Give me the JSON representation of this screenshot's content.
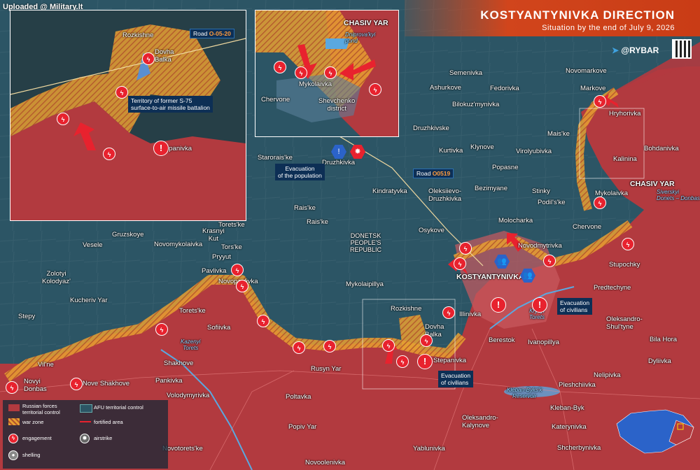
{
  "watermark": "Uploaded @ Military.lt",
  "header": {
    "title": "KOSTYANTYNIVKA DIRECTION",
    "subtitle": "Situation by the end of July 9, 2026",
    "brand": "@RYBAR"
  },
  "colors": {
    "russian": "#b23a3f",
    "afu": "#2c5565",
    "war_zone": "#e8a031",
    "accent": "#d1451c",
    "engagement": "#e8222e",
    "afu_icon": "#2b63c9"
  },
  "region_label": "DONETSK\nPEOPLE'S\nREPUBLIC",
  "places": {
    "semenivka": "Semenivka",
    "novomarkove": "Novomarkove",
    "ashurkove": "Ashurkove",
    "fedorivka": "Fedorivka",
    "markove": "Markove",
    "bilokuzmynivka": "Bilokuz'mynivka",
    "hryhorivka": "Hryhorivka",
    "druzhkivske": "Druzhkivske",
    "mais_ke": "Mais'ke",
    "kurtivka": "Kurtivka",
    "klynove": "Klynove",
    "virolyubivka": "Virolyubivka",
    "bohdanivka": "Bohdanivka",
    "starorais_ke": "Starorais'ke",
    "druzhkivka": "Druzhkivka",
    "kalinina": "Kalinina",
    "popasne": "Popasne",
    "bezimyane": "Bezimyane",
    "chasiv_yar": "CHASIV YAR",
    "stinky": "Stinky",
    "kindratyvka": "Kindratyvka",
    "oleksiievo": "Oleksiievo-\nDruzhkivka",
    "mykolaivka": "Mykolaivka",
    "rais_ke_1": "Rais'ke",
    "rais_ke_2": "Rais'ke",
    "podil_s_ke": "Podil's'ke",
    "toretske_top": "Torets'ke",
    "krasnyi_kut": "Krasnyi\nKut",
    "tors_ke": "Tors'ke",
    "pryyut": "Pryyut",
    "gruzskoye": "Gruzskoye",
    "vesele": "Vesele",
    "novomykolaivka": "Novomykolaivka",
    "osykove": "Osykove",
    "molocharka": "Molocharka",
    "chervone": "Chervone",
    "novodmytrivka": "Novodmytrivka",
    "stupochky": "Stupochky",
    "pavlivka": "Pavlivka",
    "zolotyi_kolodyaz": "Zolotyi\nKolodyaz'",
    "novopavlivka": "Novopavlivka",
    "mykolaipillya": "Mykolaipillya",
    "kostyantynivka": "KOSTYANTYNIVKA",
    "predtechyne": "Predtechyne",
    "kucheriv_yar": "Kucheriv Yar",
    "toretske_mid": "Torets'ke",
    "rozkishne": "Rozkishne",
    "dovha_balka": "Dovha\nBalka",
    "illinivka": "Illinivka",
    "stepy": "Stepy",
    "sofiivka": "Sofiivka",
    "oleksandro_shultyne": "Oleksandro-\nShul'tyne",
    "berestok": "Berestok",
    "ivanopillya": "Ivanopillya",
    "bila_hora": "Bila Hora",
    "shakhove": "Shakhove",
    "stepanivka": "Stepanivka",
    "rusyn_yar": "Rusyn Yar",
    "dyliivka": "Dyliivka",
    "vil_ne": "Vil'ne",
    "novyi_donbas": "Novyi\nDonbas",
    "nove_shakhove": "Nove Shakhove",
    "pankivka": "Pankivka",
    "nelipivka": "Nelipivka",
    "pleshchiivka": "Pleshchiivka",
    "volodymyrivka": "Volodymyrivka",
    "poltavka": "Poltavka",
    "kleban_byk": "Kleban-Byk",
    "popiv_yar": "Popiv Yar",
    "oleksandro_kalynove": "Oleksandro-\nKalynove",
    "katerynivka": "Katerynivka",
    "novotoretske": "Novotorets'ke",
    "yablunivka": "Yablunivka",
    "shcherbynivka": "Shcherbynivka",
    "novoolenivka": "Novoolenivka"
  },
  "water": {
    "kazenyi_torets": "Kazenyi\nTorets",
    "kryvyi_torets": "Kryvyi\nTorets",
    "kleban_byk_reservoir": "Kleban-Byks'k\nReservoir",
    "siverskyi_donets": "Siverskyi\nDonets – Donbas"
  },
  "callouts": {
    "road_top_prefix": "Road ",
    "road_top_code": "O0519",
    "evac_population": "Evacuation\nof the population",
    "evac_civilians_1": "Evacuation\nof civilians",
    "evac_civilians_2": "Evacuation\nof civilians"
  },
  "inset1": {
    "road_prefix": "Road ",
    "road_code": "O-05-20",
    "rozkishne": "Rozkishne",
    "dovha_balka": "Dovha\nBalka",
    "s75": "Territory of former S-75\nsurface-to-air missile battalion",
    "stepanivka": "Stepanivka"
  },
  "inset2": {
    "chasiv_yar": "CHASIV YAR",
    "pond": "Dniprova'kyi\npond",
    "mykolaivka": "Mykolaivka",
    "chervone": "Chervone",
    "shevchenko": "Shevchenko\ndistrict"
  },
  "legend": {
    "russian": "Russian forces\nterritorial control",
    "afu": "AFU territorial control",
    "war_zone": "war zone",
    "fortified": "fortified area",
    "engagement": "engagement",
    "airstrike": "airstrike",
    "shelling": "shelling"
  },
  "icons": {
    "engagement": "lightning-icon",
    "shelling": "shelling-icon",
    "airstrike": "airstrike-icon",
    "warning": "exclamation-icon",
    "evacuation": "people-icon",
    "telegram": "telegram-icon"
  }
}
